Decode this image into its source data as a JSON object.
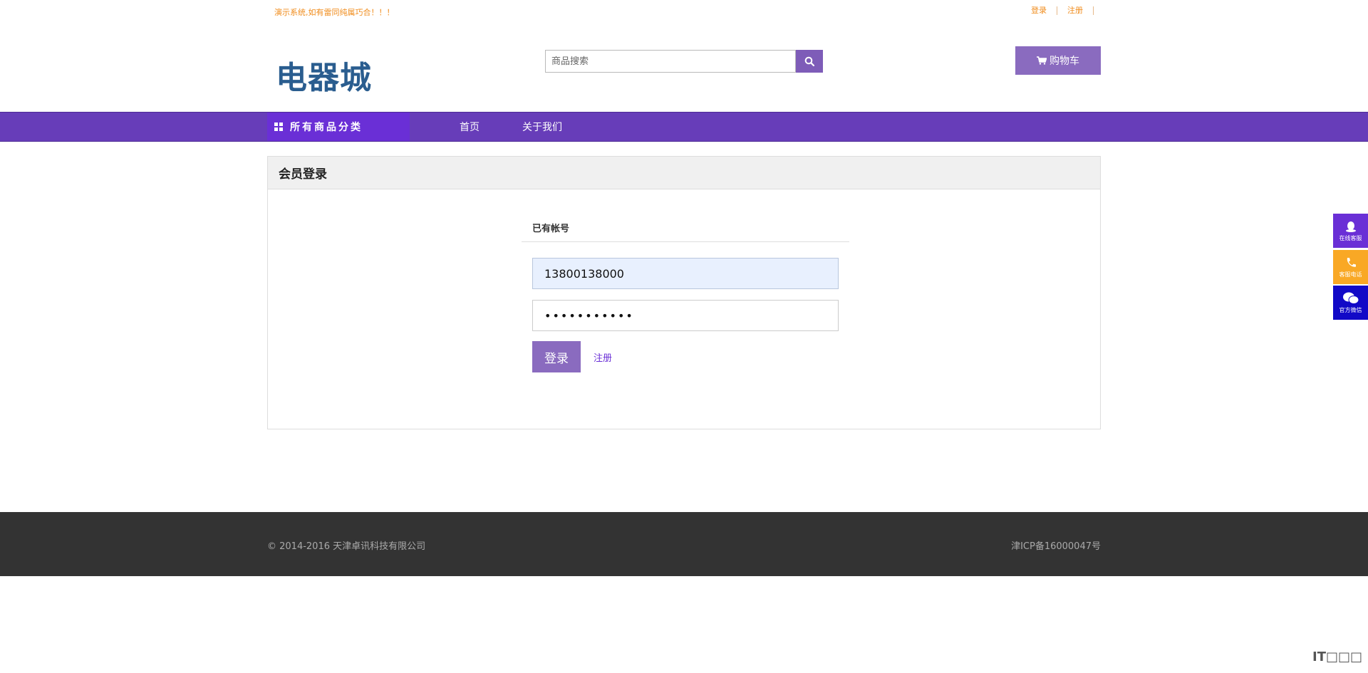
{
  "topbar": {
    "notice": "演示系统,如有雷同纯属巧合！！！",
    "login_link": "登录",
    "register_link": "注册"
  },
  "header": {
    "logo": "电器城",
    "search_placeholder": "商品搜索",
    "search_icon": "search-icon",
    "cart_label": "购物车",
    "cart_icon": "cart-icon"
  },
  "nav": {
    "all_categories": "所有商品分类",
    "items": [
      "首页",
      "关于我们"
    ]
  },
  "login": {
    "panel_title": "会员登录",
    "section_title": "已有帐号",
    "username_value": "13800138000",
    "password_value": "•••••••••••",
    "login_button": "登录",
    "register_link": "注册"
  },
  "footer": {
    "copyright": "© 2014-2016 天津卓讯科技有限公司",
    "icp": "津ICP备16000047号"
  },
  "float": {
    "qq_label": "在线客服",
    "tel_label": "客服电话",
    "wechat_label": "官方微信"
  },
  "watermark": "IT□□□",
  "colors": {
    "brand_purple": "#673db9",
    "button_purple": "#8a6bbf",
    "notice_orange": "#f08c1c",
    "footer_bg": "#333333"
  }
}
